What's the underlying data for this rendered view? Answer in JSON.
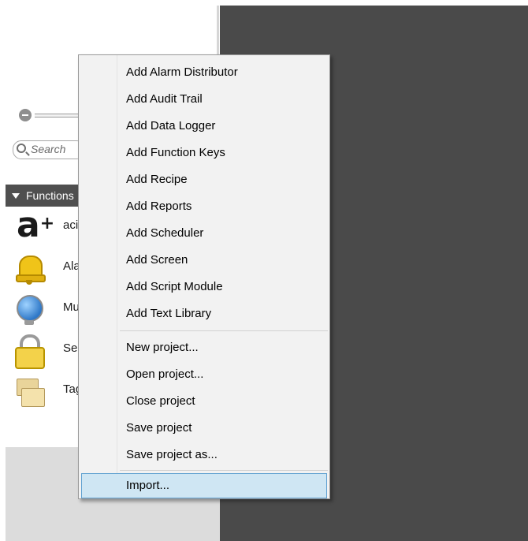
{
  "left_panel": {
    "search": {
      "placeholder": "Search"
    },
    "section_header": {
      "label": "Functions"
    },
    "items": [
      {
        "label": "acid",
        "icon": "a-plus-icon"
      },
      {
        "label": "Alarm",
        "icon": "bell-icon"
      },
      {
        "label": "Multi",
        "icon": "globe-icon"
      },
      {
        "label": "Security",
        "icon": "lock-icon"
      },
      {
        "label": "Tags",
        "icon": "folders-icon"
      }
    ]
  },
  "context_menu": {
    "add_items": [
      "Add Alarm Distributor",
      "Add Audit Trail",
      "Add Data Logger",
      "Add Function Keys",
      "Add Recipe",
      "Add Reports",
      "Add Scheduler",
      "Add Screen",
      "Add Script Module",
      "Add Text Library"
    ],
    "project_items": [
      "New project...",
      "Open project...",
      "Close project",
      "Save project",
      "Save project as..."
    ],
    "import_item": "Import...",
    "selected_item": "Import..."
  },
  "colors": {
    "dark_background": "#4a4a4a",
    "menu_background": "#f2f2f2",
    "selection_fill": "#cfe6f3",
    "selection_border": "#5fa0d0",
    "section_header_bg": "#4f4f4f"
  }
}
